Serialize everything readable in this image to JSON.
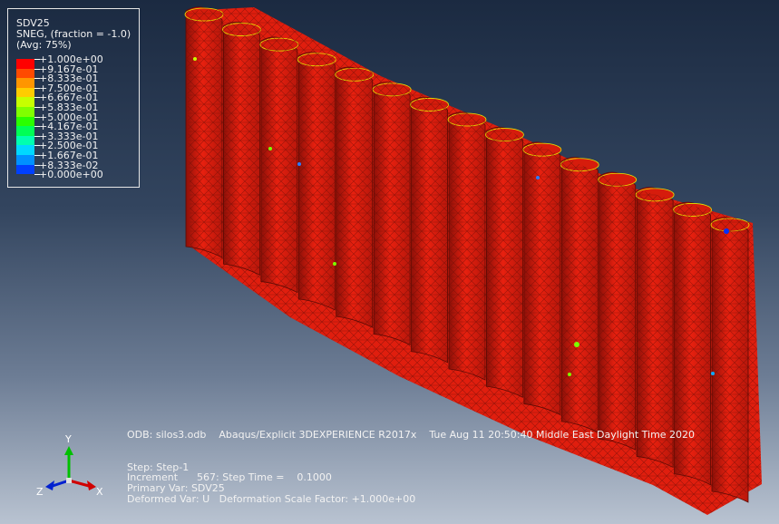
{
  "legend": {
    "title": "SDV25",
    "subtitle": "SNEG, (fraction = -1.0)",
    "avg": "(Avg: 75%)",
    "values": [
      "+1.000e+00",
      "+9.167e-01",
      "+8.333e-01",
      "+7.500e-01",
      "+6.667e-01",
      "+5.833e-01",
      "+5.000e-01",
      "+4.167e-01",
      "+3.333e-01",
      "+2.500e-01",
      "+1.667e-01",
      "+8.333e-02",
      "+0.000e+00"
    ],
    "colors": [
      "#ff0000",
      "#ff4a00",
      "#ff9500",
      "#ffcc00",
      "#c7ff00",
      "#80ff00",
      "#2aff00",
      "#00ff55",
      "#00ffb0",
      "#00d8ff",
      "#0091ff",
      "#0040ff",
      "#0000ff"
    ]
  },
  "info": {
    "odb_line": "ODB: silos3.odb    Abaqus/Explicit 3DEXPERIENCE R2017x    Tue Aug 11 20:50:40 Middle East Daylight Time 2020",
    "step": "Step: Step-1",
    "increment": "Increment      567: Step Time =    0.1000",
    "primary_var": "Primary Var: SDV25",
    "deformed_var": "Deformed Var: U   Deformation Scale Factor: +1.000e+00"
  },
  "triad": {
    "x": "X",
    "y": "Y",
    "z": "Z"
  },
  "model": {
    "silo_count": 15,
    "main_color": "#e8200f",
    "mesh_color": "#6a0d06"
  }
}
